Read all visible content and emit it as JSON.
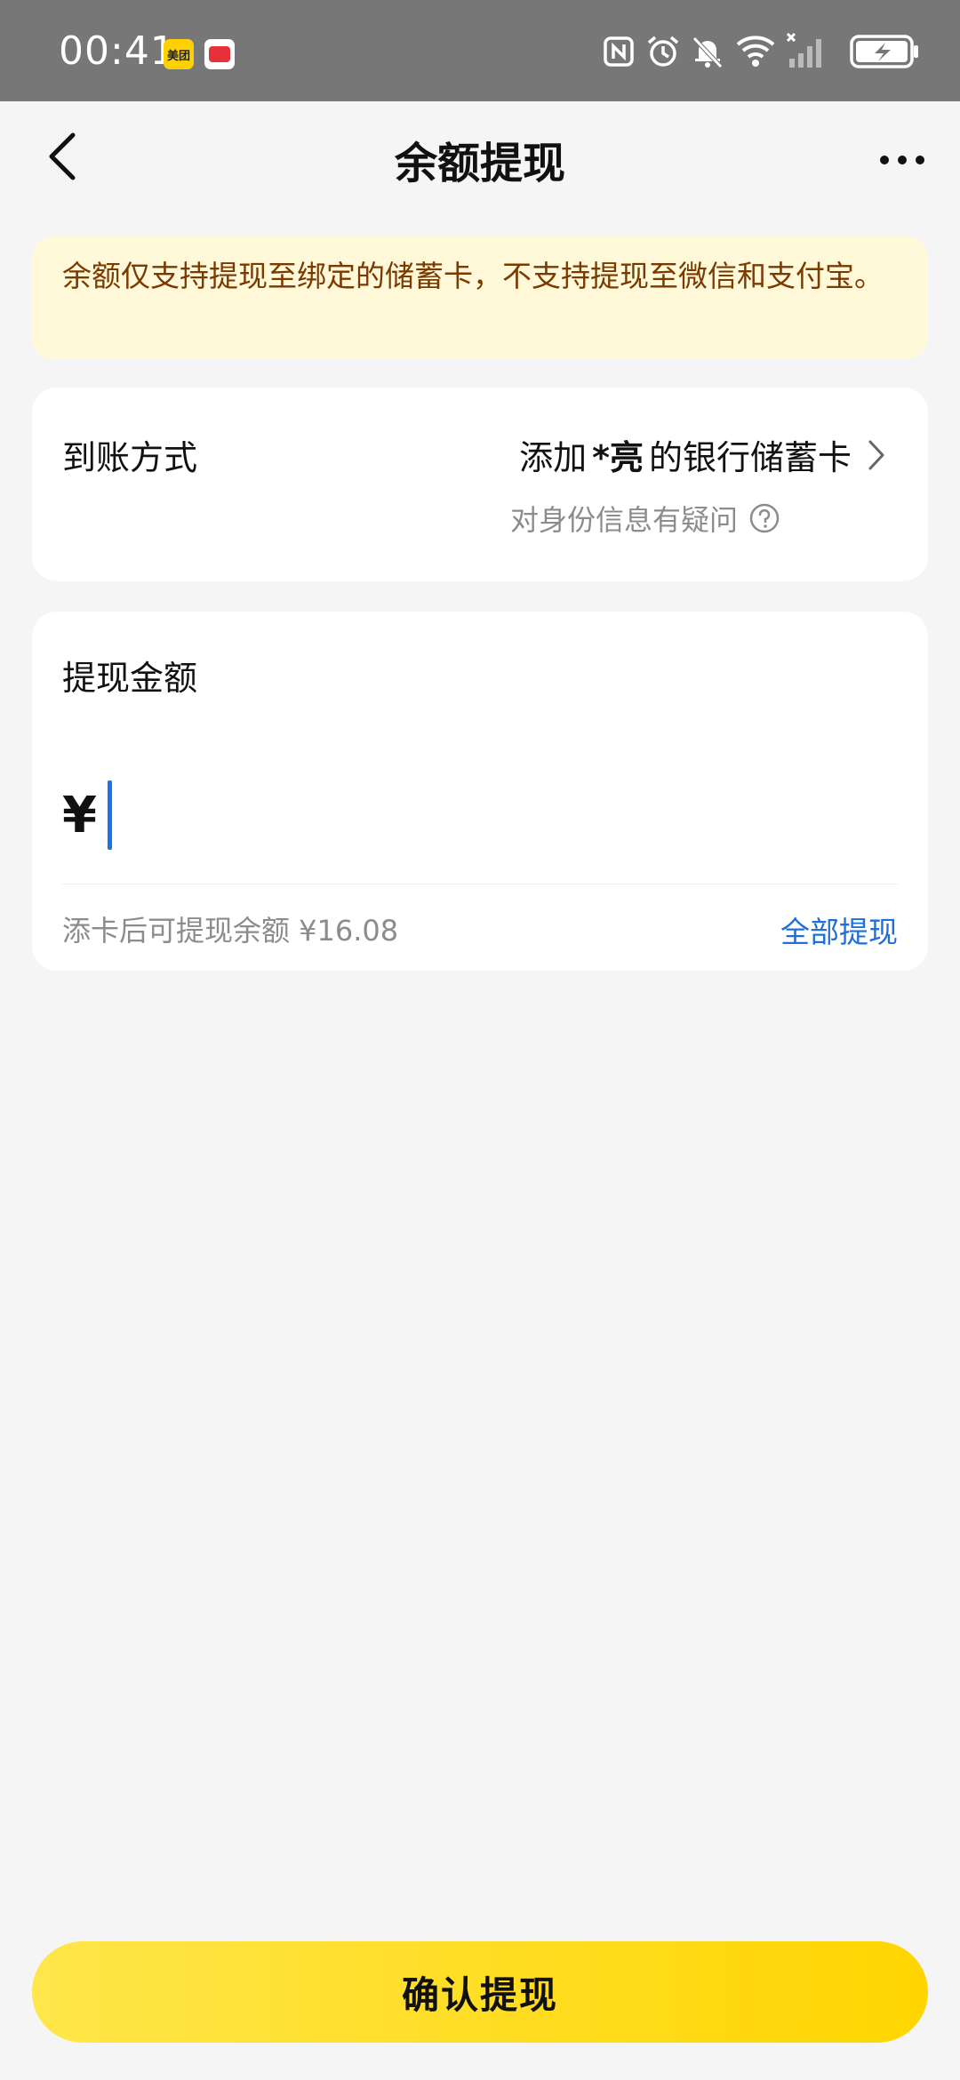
{
  "status_bar": {
    "time": "00:41",
    "meituan_badge": "美团"
  },
  "nav": {
    "title": "余额提现"
  },
  "notice": {
    "text": "余额仅支持提现至绑定的储蓄卡，不支持提现至微信和支付宝。"
  },
  "method": {
    "label": "到账方式",
    "value_prefix": "添加 ",
    "value_name": "*亮",
    "value_suffix": " 的银行储蓄卡",
    "identity_question": "对身份信息有疑问"
  },
  "amount": {
    "label": "提现金额",
    "currency": "¥",
    "value": "",
    "available_text": "添卡后可提现余额 ¥16.08",
    "withdraw_all": "全部提现"
  },
  "confirm": {
    "label": "确认提现"
  },
  "colors": {
    "accent_yellow": "#ffd500",
    "notice_bg": "#fff8d9",
    "link_blue": "#1e6fd9"
  }
}
